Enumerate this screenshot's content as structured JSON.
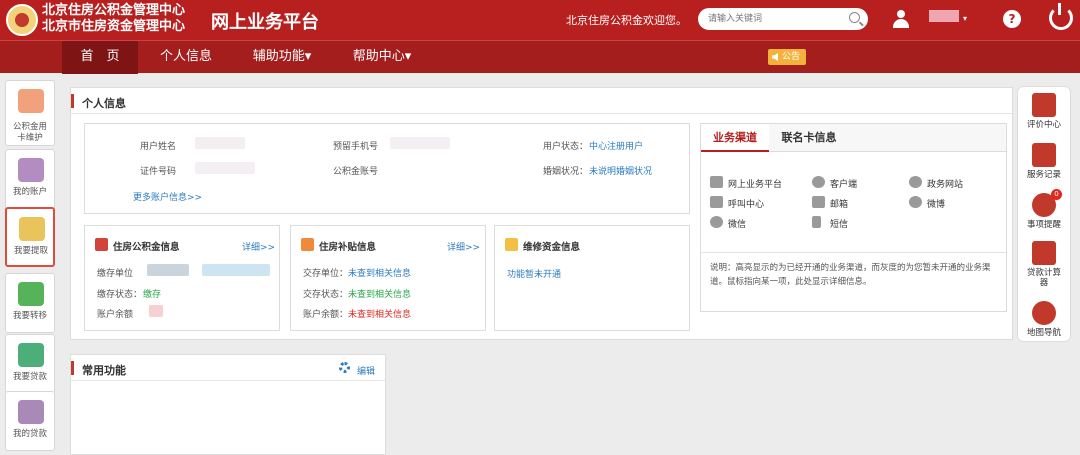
{
  "header": {
    "org_line1": "北京住房公积金管理中心",
    "org_line2": "北京市住房资金管理中心",
    "platform_title": "网上业务平台",
    "welcome": "北京住房公积金欢迎您。",
    "search_placeholder": "请输入关键词",
    "user_caret": "▾",
    "help_glyph": "?"
  },
  "nav": {
    "items": [
      {
        "label": "首　页"
      },
      {
        "label": "个人信息"
      },
      {
        "label": "辅助功能▾"
      },
      {
        "label": "帮助中心▾"
      }
    ],
    "announce": "公告"
  },
  "left_sidebar": {
    "items": [
      {
        "label": "公积金用\n卡维护"
      },
      {
        "label": "我的账户"
      },
      {
        "label": "我要提取"
      },
      {
        "label": "我要转移"
      },
      {
        "label": "我要贷款"
      },
      {
        "label": "我的贷款"
      }
    ],
    "selected": "我要提取"
  },
  "personal_info": {
    "title": "个人信息",
    "fields": {
      "name_label": "用户姓名",
      "phone_label": "预留手机号",
      "status_label": "用户状态：",
      "status_value": "中心注册用户",
      "id_label": "证件号码",
      "account_label": "公积金账号",
      "marital_label": "婚姻状况：",
      "marital_value": "未说明婚姻状况"
    },
    "more_link": "更多账户信息>>"
  },
  "cards": {
    "fund": {
      "title": "住房公积金信息",
      "more": "详细>>",
      "unit_label": "缴存单位",
      "status_label": "缴存状态：",
      "status_value": "缴存",
      "balance_label": "账户余额"
    },
    "subsidy": {
      "title": "住房补贴信息",
      "more": "详细>>",
      "unit_label": "交存单位：",
      "unit_value": "未查到相关信息",
      "status_label": "交存状态：",
      "status_value": "未查到相关信息",
      "balance_label": "账户余额：",
      "balance_value": "未查到相关信息"
    },
    "repair": {
      "title": "维修资金信息",
      "status": "功能暂未开通"
    }
  },
  "channels": {
    "tabs": [
      "业务渠道",
      "联名卡信息"
    ],
    "items": [
      "网上业务平台",
      "客户端",
      "政务网站",
      "呼叫中心",
      "邮箱",
      "微博",
      "微信",
      "短信"
    ],
    "note": "说明：高亮显示的为已经开通的业务渠道，而灰度的为您暂未开通的业务渠道。鼠标指向某一项，此处显示详细信息。"
  },
  "common": {
    "title": "常用功能",
    "edit": "编辑"
  },
  "right_sidebar": {
    "items": [
      {
        "label": "评价中心"
      },
      {
        "label": "服务记录"
      },
      {
        "label": "事项提醒",
        "badge": "0"
      },
      {
        "label": "贷款计算器"
      },
      {
        "label": "地图导航"
      }
    ]
  },
  "colors": {
    "brand_red": "#b8201f",
    "link_blue": "#2a7bbf",
    "ok_green": "#27a84a",
    "warn_red": "#e0281f"
  }
}
